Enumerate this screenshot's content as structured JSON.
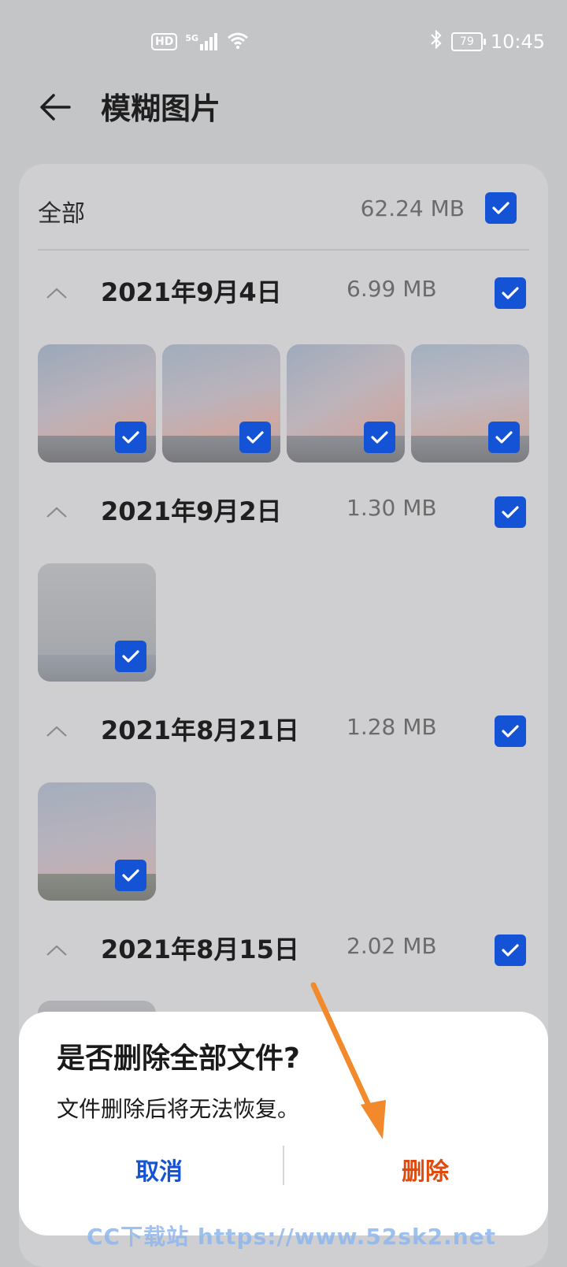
{
  "status_bar": {
    "hd_label": "HD",
    "network": "5G",
    "battery": "79",
    "time": "10:45"
  },
  "header": {
    "title": "模糊图片"
  },
  "all_row": {
    "label": "全部",
    "size": "62.24 MB",
    "checked": true
  },
  "groups": [
    {
      "date": "2021年9月4日",
      "size": "6.99 MB",
      "checked": true,
      "thumb_count": 4
    },
    {
      "date": "2021年9月2日",
      "size": "1.30 MB",
      "checked": true,
      "thumb_count": 1
    },
    {
      "date": "2021年8月21日",
      "size": "1.28 MB",
      "checked": true,
      "thumb_count": 1
    },
    {
      "date": "2021年8月15日",
      "size": "2.02 MB",
      "checked": true,
      "thumb_count": 1
    }
  ],
  "dialog": {
    "title": "是否删除全部文件?",
    "message": "文件删除后将无法恢复。",
    "cancel_label": "取消",
    "delete_label": "删除"
  },
  "watermark": "CC下载站  https://www.52sk2.net",
  "colors": {
    "accent_blue": "#1553d6",
    "delete_orange": "#e04a0c",
    "annotation_arrow": "#f28a2c"
  }
}
